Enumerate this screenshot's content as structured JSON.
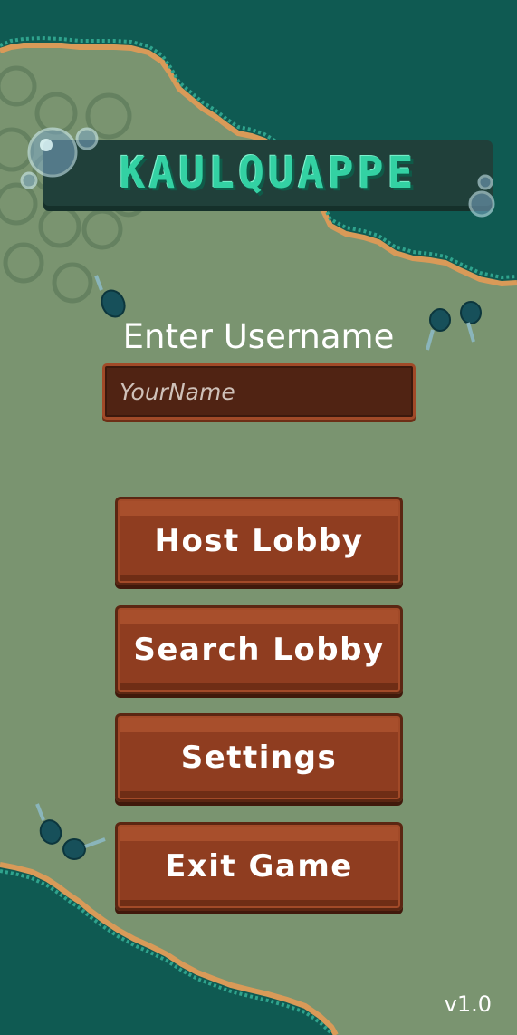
{
  "title": {
    "game_name": "KAULQUAPPE"
  },
  "username": {
    "label": "Enter Username",
    "placeholder": "YourName",
    "value": ""
  },
  "menu": {
    "host_label": "Host Lobby",
    "search_label": "Search Lobby",
    "settings_label": "Settings",
    "exit_label": "Exit Game"
  },
  "footer": {
    "version": "v1.0"
  },
  "icons": {
    "bubbles": "bubble-icon",
    "tadpoles": "tadpole-icon"
  },
  "colors": {
    "background": "#7a9470",
    "water": "#0f5a52",
    "sand": "#d99a58",
    "button": "#8f3d20",
    "input_bg": "#502313",
    "logo": "#33d1a3"
  }
}
